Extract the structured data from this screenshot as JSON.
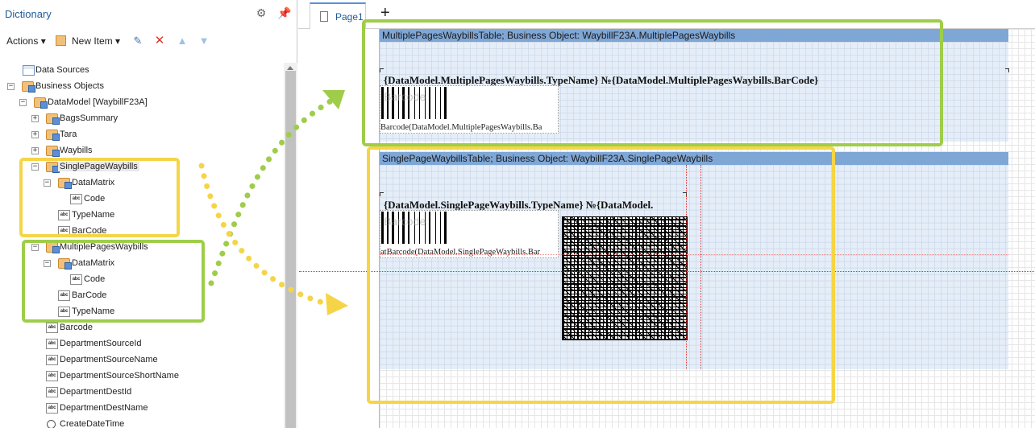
{
  "dictionary": {
    "title": "Dictionary",
    "header_icons": [
      "gear-icon",
      "pin-icon"
    ],
    "toolbar": {
      "actions_label": "Actions",
      "new_item_label": "New Item"
    }
  },
  "tree": {
    "data_sources": "Data Sources",
    "business_objects": "Business Objects",
    "data_model": "DataModel [WaybillF23A]",
    "bags_summary": "BagsSummary",
    "tara": "Tara",
    "waybills": "Waybills",
    "single_page_waybills": "SinglePageWaybills",
    "single_data_matrix": "DataMatrix",
    "single_code": "Code",
    "single_type_name": "TypeName",
    "single_bar_code": "BarCode",
    "multiple_pages_waybills": "MultiplePagesWaybills",
    "multi_data_matrix": "DataMatrix",
    "multi_code": "Code",
    "multi_bar_code": "BarCode",
    "multi_type_name": "TypeName",
    "barcode": "Barcode",
    "department_source_id": "DepartmentSourceId",
    "department_source_name": "DepartmentSourceName",
    "department_source_short_name": "DepartmentSourceShortName",
    "department_dest_id": "DepartmentDestId",
    "department_dest_name": "DepartmentDestName",
    "create_date_time": "CreateDateTime",
    "column_icon_text": "abc"
  },
  "designer": {
    "tab_label": "Page1",
    "add_tab": "+",
    "multi_band": {
      "header": "MultiplePagesWaybillsTable; Business Object: WaybillF23A.MultiplePagesWaybills",
      "caption": "{DataModel.MultiplePagesWaybills.TypeName} №{DataModel.MultiplePagesWaybills.BarCode}",
      "barcode_label": "Barcode(DataModel.MultiplePagesWaybills.Ba"
    },
    "single_band": {
      "header": "SinglePageWaybillsTable; Business Object: WaybillF23A.SinglePageWaybills",
      "caption": "{DataModel.SinglePageWaybills.TypeName} №{DataModel.",
      "barcode_label": "atBarcode(DataModel.SinglePageWaybills.Bar"
    },
    "barcode_ghost": "Barcode"
  },
  "annotations": {
    "yellow": "#f5d547",
    "green": "#9fcd4a"
  }
}
